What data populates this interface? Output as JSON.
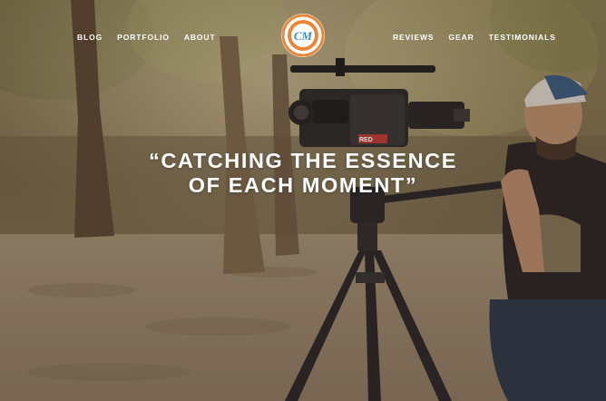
{
  "nav": {
    "left": [
      {
        "label": "BLOG"
      },
      {
        "label": "PORTFOLIO"
      },
      {
        "label": "ABOUT"
      }
    ],
    "right": [
      {
        "label": "REVIEWS"
      },
      {
        "label": "GEAR"
      },
      {
        "label": "TESTIMONIALS"
      }
    ]
  },
  "logo": {
    "monogram": "CM",
    "icon": "circular-badge-logo"
  },
  "hero": {
    "headline_line1": "“CATCHING THE ESSENCE",
    "headline_line2": "OF EACH MOMENT”",
    "camera_brand": "RED"
  },
  "colors": {
    "logo_orange": "#e8873a",
    "logo_blue": "#3a8fc4",
    "text": "#ffffff"
  }
}
